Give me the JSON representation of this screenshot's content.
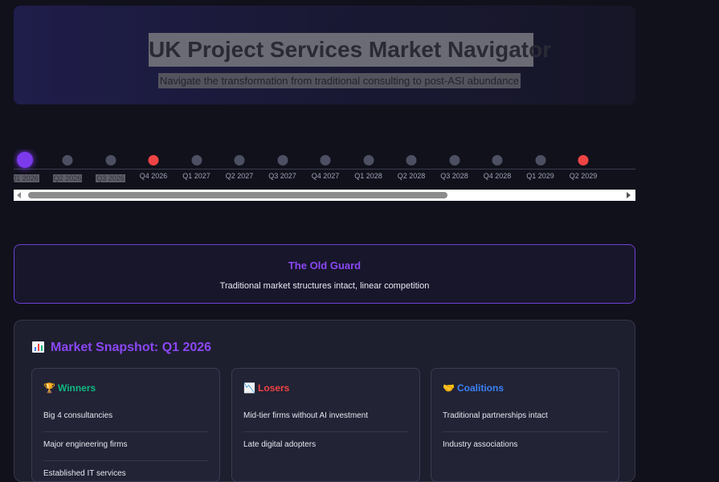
{
  "header": {
    "title": "UK Project Services Market Navigator",
    "subtitle": "Navigate the transformation from traditional consulting to post-ASI abundance"
  },
  "timeline": {
    "items": [
      {
        "label": "Q1 2026",
        "state": "active"
      },
      {
        "label": "Q2 2026",
        "state": "normal"
      },
      {
        "label": "Q3 2026",
        "state": "normal"
      },
      {
        "label": "Q4 2026",
        "state": "alert"
      },
      {
        "label": "Q1 2027",
        "state": "normal"
      },
      {
        "label": "Q2 2027",
        "state": "normal"
      },
      {
        "label": "Q3 2027",
        "state": "normal"
      },
      {
        "label": "Q4 2027",
        "state": "normal"
      },
      {
        "label": "Q1 2028",
        "state": "normal"
      },
      {
        "label": "Q2 2028",
        "state": "normal"
      },
      {
        "label": "Q3 2028",
        "state": "normal"
      },
      {
        "label": "Q4 2028",
        "state": "normal"
      },
      {
        "label": "Q1 2029",
        "state": "normal"
      },
      {
        "label": "Q2 2029",
        "state": "alert"
      }
    ]
  },
  "era": {
    "title": "The Old Guard",
    "description": "Traditional market structures intact, linear competition"
  },
  "snapshot": {
    "title": "Market Snapshot: Q1 2026",
    "icon": "bar-chart-icon",
    "panels": [
      {
        "key": "winners",
        "icon": "trophy-icon",
        "glyph": "🏆",
        "title": "Winners",
        "color": "#10b981",
        "items": [
          "Big 4 consultancies",
          "Major engineering firms",
          "Established IT services"
        ]
      },
      {
        "key": "losers",
        "icon": "chart-down-icon",
        "glyph": "📉",
        "title": "Losers",
        "color": "#ef4444",
        "items": [
          "Mid-tier firms without AI investment",
          "Late digital adopters"
        ]
      },
      {
        "key": "coalitions",
        "icon": "handshake-icon",
        "glyph": "🤝",
        "title": "Coalitions",
        "color": "#3b82f6",
        "items": [
          "Traditional partnerships intact",
          "Industry associations"
        ]
      }
    ]
  },
  "colors": {
    "accent": "#8b47f5",
    "alert": "#ef4444",
    "background": "#11111c"
  }
}
